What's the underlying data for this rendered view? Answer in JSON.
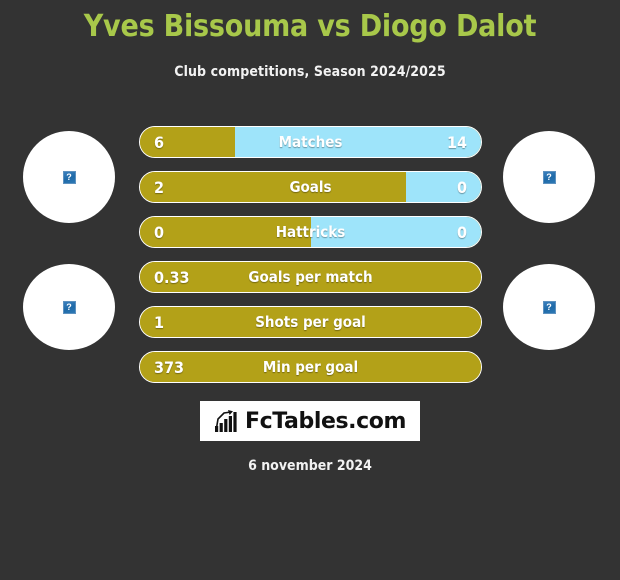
{
  "header": {
    "title": "Yves Bissouma vs Diogo Dalot",
    "subtitle": "Club competitions, Season 2024/2025"
  },
  "colors": {
    "background": "#333333",
    "title": "#a8c84a",
    "home_bar": "#b3a118",
    "away_bar": "#9ee4fa",
    "text": "#ffffff"
  },
  "players": {
    "home": {
      "name": "Yves Bissouma",
      "photo_icon": "broken-image-icon"
    },
    "away": {
      "name": "Diogo Dalot",
      "photo_icon": "broken-image-icon"
    }
  },
  "photo_placeholders": [
    {
      "position": "top-left",
      "icon": "broken-image-icon",
      "glyph": "?"
    },
    {
      "position": "top-right",
      "icon": "broken-image-icon",
      "glyph": "?"
    },
    {
      "position": "bottom-left",
      "icon": "broken-image-icon",
      "glyph": "?"
    },
    {
      "position": "bottom-right",
      "icon": "broken-image-icon",
      "glyph": "?"
    }
  ],
  "chart_data": {
    "type": "bar",
    "title": "Yves Bissouma vs Diogo Dalot",
    "subtitle": "Club competitions, Season 2024/2025",
    "orientation": "horizontal-diverging",
    "series": [
      {
        "name": "Yves Bissouma",
        "color": "#b3a118"
      },
      {
        "name": "Diogo Dalot",
        "color": "#9ee4fa"
      }
    ],
    "categories": [
      "Matches",
      "Goals",
      "Hattricks",
      "Goals per match",
      "Shots per goal",
      "Min per goal"
    ],
    "rows": [
      {
        "label": "Matches",
        "left_value": "6",
        "right_value": "14",
        "left_pct": 28,
        "right_pct": 72,
        "show_right": true
      },
      {
        "label": "Goals",
        "left_value": "2",
        "right_value": "0",
        "left_pct": 78,
        "right_pct": 22,
        "show_right": true
      },
      {
        "label": "Hattricks",
        "left_value": "0",
        "right_value": "0",
        "left_pct": 50,
        "right_pct": 50,
        "show_right": true
      },
      {
        "label": "Goals per match",
        "left_value": "0.33",
        "right_value": "",
        "left_pct": 100,
        "right_pct": 0,
        "show_right": false
      },
      {
        "label": "Shots per goal",
        "left_value": "1",
        "right_value": "",
        "left_pct": 100,
        "right_pct": 0,
        "show_right": false
      },
      {
        "label": "Min per goal",
        "left_value": "373",
        "right_value": "",
        "left_pct": 100,
        "right_pct": 0,
        "show_right": false
      }
    ]
  },
  "footer": {
    "logo_text": "FcTables.com",
    "logo_icon": "bar-chart-growth-icon",
    "date": "6 november 2024"
  }
}
